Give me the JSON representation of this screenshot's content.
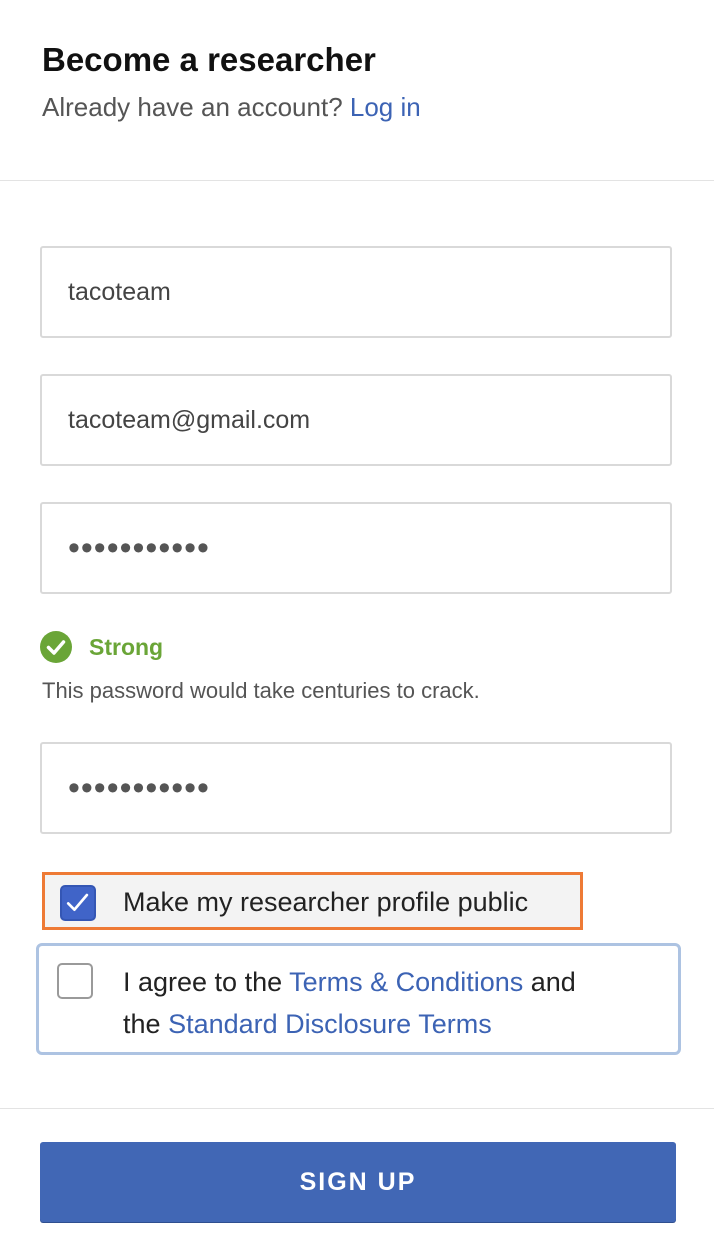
{
  "header": {
    "title": "Become a researcher",
    "login_prompt": "Already have an account?",
    "login_link": "Log in"
  },
  "form": {
    "username_value": "tacoteam",
    "email_value": "tacoteam@gmail.com",
    "password_value": "•••••••••••",
    "confirm_password_value": "•••••••••••"
  },
  "password_strength": {
    "label": "Strong",
    "hint": "This password would take centuries to crack.",
    "color": "#6aa537"
  },
  "options": {
    "public_profile": {
      "label": "Make my researcher profile public",
      "checked": true
    },
    "terms": {
      "prefix": "I agree to the",
      "terms_link": "Terms & Conditions",
      "conjunction": "and",
      "the_word": "the",
      "disclosure_link": "Standard Disclosure Terms",
      "checked": false
    }
  },
  "signup_button": "SIGN UP",
  "colors": {
    "accent": "#4167b5",
    "link": "#3c63b4",
    "highlight_border": "#ee7a35",
    "focus_border": "#adc3e2"
  }
}
